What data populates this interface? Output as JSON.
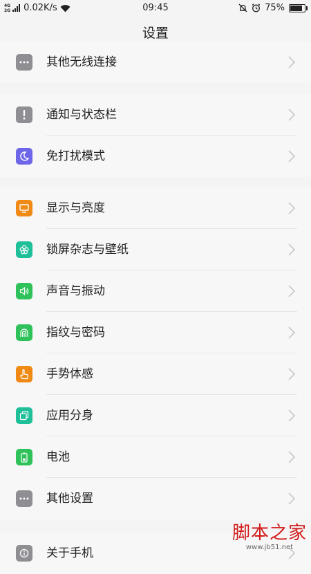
{
  "status_bar": {
    "network_top": "4G",
    "network_bottom": "2G",
    "speed": "0.02K/s",
    "time": "09:45",
    "battery": "75%"
  },
  "title": "设置",
  "sections": [
    {
      "items": [
        {
          "label": "其他无线连接",
          "icon": "more-dots-icon",
          "color": "#8e8e93"
        }
      ]
    },
    {
      "items": [
        {
          "label": "通知与状态栏",
          "icon": "exclamation-icon",
          "color": "#8e8e93"
        },
        {
          "label": "免打扰模式",
          "icon": "moon-icon",
          "color": "#6e66e8"
        }
      ]
    },
    {
      "items": [
        {
          "label": "显示与亮度",
          "icon": "monitor-icon",
          "color": "#f08a14"
        },
        {
          "label": "锁屏杂志与壁纸",
          "icon": "flower-icon",
          "color": "#1fbf9a"
        },
        {
          "label": "声音与振动",
          "icon": "speaker-icon",
          "color": "#2fc25b"
        },
        {
          "label": "指纹与密码",
          "icon": "fingerprint-icon",
          "color": "#2fc25b"
        },
        {
          "label": "手势体感",
          "icon": "hand-icon",
          "color": "#f08a14"
        },
        {
          "label": "应用分身",
          "icon": "app-clone-icon",
          "color": "#1fbf9a"
        },
        {
          "label": "电池",
          "icon": "battery-icon",
          "color": "#2fc25b"
        },
        {
          "label": "其他设置",
          "icon": "more-dots-icon",
          "color": "#8e8e93"
        }
      ]
    },
    {
      "items": [
        {
          "label": "关于手机",
          "icon": "info-icon",
          "color": "#8e8e93"
        }
      ]
    }
  ],
  "watermark": {
    "top": "脚本之家",
    "bottom": "www.jb51.net"
  }
}
